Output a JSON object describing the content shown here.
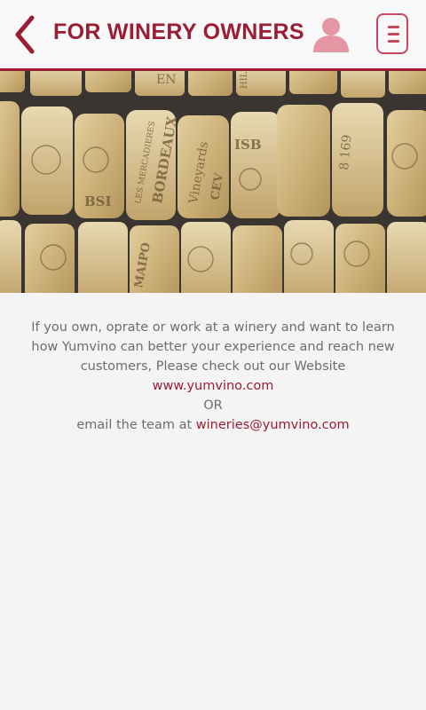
{
  "header": {
    "title": "FOR WINERY OWNERS",
    "back_icon": "chevron-left-icon",
    "profile_icon": "user-icon",
    "menu_icon": "menu-icon",
    "accent_color": "#9b1d34",
    "icon_color": "#c9485f"
  },
  "banner": {
    "image": "wine-corks-photo",
    "cork_text": [
      "EN",
      "BORDEAUX",
      "LES MERCADIERES",
      "Vineyards",
      "CEV",
      "ISB",
      "BSI",
      "8 169",
      "MAIPO",
      "HILLS"
    ]
  },
  "message": {
    "line1": "If you own, oprate or work at a winery and want to learn",
    "line2": "how Yumvino can better your experience and reach new",
    "line3": "customers, Please check out our Website",
    "website_link": "www.yumvino.com",
    "or_text": "OR",
    "email_prefix": "email the team at ",
    "email_link": "wineries@yumvino.com"
  }
}
